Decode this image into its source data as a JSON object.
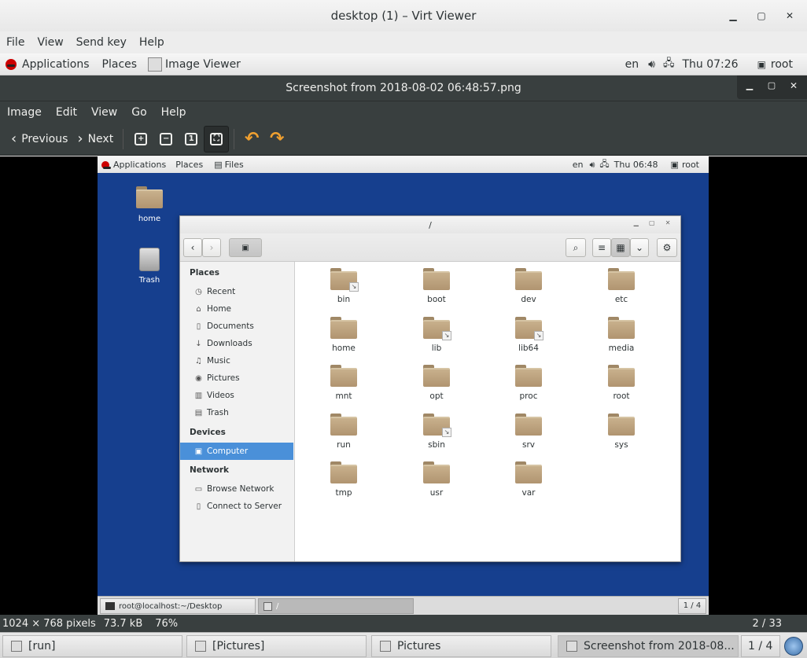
{
  "virt_viewer": {
    "title": "desktop (1) – Virt Viewer",
    "menu": [
      "File",
      "View",
      "Send key",
      "Help"
    ]
  },
  "guest_panel": {
    "applications": "Applications",
    "places": "Places",
    "active_app": "Image Viewer",
    "lang": "en",
    "clock": "Thu 07:26",
    "user": "root"
  },
  "image_viewer": {
    "title": "Screenshot from 2018-08-02 06:48:57.png",
    "menu": [
      "Image",
      "Edit",
      "View",
      "Go",
      "Help"
    ],
    "toolbar": {
      "previous": "Previous",
      "next": "Next"
    },
    "status": {
      "dimensions": "1024 × 768 pixels",
      "size": "73.7 kB",
      "zoom": "76%",
      "position": "2 / 33"
    }
  },
  "inner": {
    "panel": {
      "applications": "Applications",
      "places": "Places",
      "active_app": "Files",
      "lang": "en",
      "clock": "Thu 06:48",
      "user": "root"
    },
    "desktop_icons": [
      "home",
      "Trash"
    ],
    "files_window": {
      "title": "/",
      "sidebar": {
        "places_header": "Places",
        "places": [
          "Recent",
          "Home",
          "Documents",
          "Downloads",
          "Music",
          "Pictures",
          "Videos",
          "Trash"
        ],
        "devices_header": "Devices",
        "devices": [
          "Computer"
        ],
        "network_header": "Network",
        "network": [
          "Browse Network",
          "Connect to Server"
        ]
      },
      "folders": [
        "bin",
        "boot",
        "dev",
        "etc",
        "home",
        "lib",
        "lib64",
        "media",
        "mnt",
        "opt",
        "proc",
        "root",
        "run",
        "sbin",
        "srv",
        "sys",
        "tmp",
        "usr",
        "var"
      ]
    },
    "bottom": {
      "task1": "root@localhost:~/Desktop",
      "task2": "/",
      "pager": "1 / 4"
    }
  },
  "taskbar": {
    "tasks": [
      "[run]",
      "[Pictures]",
      "Pictures",
      "Screenshot from 2018-08..."
    ],
    "pager": "1 / 4"
  }
}
